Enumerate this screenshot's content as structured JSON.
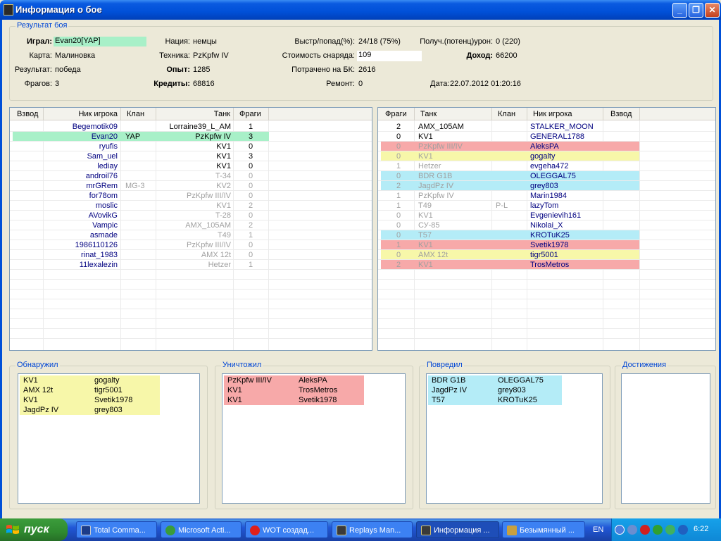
{
  "window": {
    "title": "Информация о бое"
  },
  "result_section": {
    "legend": "Результат боя",
    "played_label": "Играл:",
    "played_value": "Evan20[YAP]",
    "map_label": "Карта:",
    "map_value": "Малиновка",
    "result_label": "Результат:",
    "result_value": "победа",
    "frags_label": "Фрагов:",
    "frags_value": "3",
    "nation_label": "Нация:",
    "nation_value": "немцы",
    "tank_label": "Техника:",
    "tank_value": "PzKpfw IV",
    "xp_label": "Опыт:",
    "xp_value": "1285",
    "credits_label": "Кредиты:",
    "credits_value": "68816",
    "shots_label": "Выстр/попад(%):",
    "shots_value": "24/18 (75%)",
    "shell_cost_label": "Стоимость снаряда:",
    "shell_cost_value": "109",
    "ammo_spent_label": "Потрачено на БК:",
    "ammo_spent_value": "2616",
    "repair_label": "Ремонт:",
    "repair_value": "0",
    "dmg_label": "Получ.(потенц)урон:",
    "dmg_value": "0 (220)",
    "income_label": "Доход:",
    "income_value": "66200",
    "date_label": "Дата:",
    "date_value": "22.07.2012 01:20:16"
  },
  "left_table": {
    "headers": [
      "Взвод",
      "Ник игрока",
      "Клан",
      "Танк",
      "Фраги"
    ],
    "rows": [
      {
        "player": "Begemotik09",
        "clan": "",
        "tank": "Lorraine39_L_AM",
        "frags": "1",
        "alive": true
      },
      {
        "player": "Evan20",
        "clan": "YAP",
        "tank": "PzKpfw IV",
        "frags": "3",
        "alive": true,
        "self": true
      },
      {
        "player": "ryufis",
        "clan": "",
        "tank": "KV1",
        "frags": "0",
        "alive": true
      },
      {
        "player": "Sam_uel",
        "clan": "",
        "tank": "KV1",
        "frags": "3",
        "alive": true
      },
      {
        "player": "lediay",
        "clan": "",
        "tank": "KV1",
        "frags": "0",
        "alive": true
      },
      {
        "player": "androil76",
        "clan": "",
        "tank": "T-34",
        "frags": "0",
        "alive": false
      },
      {
        "player": "mrGRem",
        "clan": "MG-3",
        "tank": "KV2",
        "frags": "0",
        "alive": false
      },
      {
        "player": "for78om",
        "clan": "",
        "tank": "PzKpfw III/IV",
        "frags": "0",
        "alive": false
      },
      {
        "player": "moslic",
        "clan": "",
        "tank": "KV1",
        "frags": "2",
        "alive": false
      },
      {
        "player": "AVovikG",
        "clan": "",
        "tank": "T-28",
        "frags": "0",
        "alive": false
      },
      {
        "player": "Vampic",
        "clan": "",
        "tank": "AMX_105AM",
        "frags": "2",
        "alive": false
      },
      {
        "player": "asmade",
        "clan": "",
        "tank": "T49",
        "frags": "1",
        "alive": false
      },
      {
        "player": "1986110126",
        "clan": "",
        "tank": "PzKpfw III/IV",
        "frags": "0",
        "alive": false
      },
      {
        "player": "rinat_1983",
        "clan": "",
        "tank": "AMX 12t",
        "frags": "0",
        "alive": false
      },
      {
        "player": "11lexalezin",
        "clan": "",
        "tank": "Hetzer",
        "frags": "1",
        "alive": false
      }
    ]
  },
  "right_table": {
    "headers": [
      "Фраги",
      "Танк",
      "Клан",
      "Ник игрока",
      "Взвод"
    ],
    "rows": [
      {
        "frags": "2",
        "tank": "AMX_105AM",
        "clan": "",
        "player": "STALKER_MOON",
        "alive": true,
        "mark": ""
      },
      {
        "frags": "0",
        "tank": "KV1",
        "clan": "",
        "player": "GENERAL1788",
        "alive": true,
        "mark": ""
      },
      {
        "frags": "0",
        "tank": "PzKpfw III/IV",
        "clan": "",
        "player": "AleksPA",
        "alive": false,
        "mark": "killed"
      },
      {
        "frags": "0",
        "tank": "KV1",
        "clan": "",
        "player": "gogalty",
        "alive": false,
        "mark": "spotted"
      },
      {
        "frags": "1",
        "tank": "Hetzer",
        "clan": "",
        "player": "evgeha472",
        "alive": false,
        "mark": ""
      },
      {
        "frags": "0",
        "tank": "BDR G1B",
        "clan": "",
        "player": "OLEGGAL75",
        "alive": false,
        "mark": "damaged"
      },
      {
        "frags": "2",
        "tank": "JagdPz IV",
        "clan": "",
        "player": "grey803",
        "alive": false,
        "mark": "damaged"
      },
      {
        "frags": "1",
        "tank": "PzKpfw IV",
        "clan": "",
        "player": "Marin1984",
        "alive": false,
        "mark": ""
      },
      {
        "frags": "1",
        "tank": "T49",
        "clan": "P-L",
        "player": "lazyTom",
        "alive": false,
        "mark": ""
      },
      {
        "frags": "0",
        "tank": "KV1",
        "clan": "",
        "player": "Evgenievih161",
        "alive": false,
        "mark": ""
      },
      {
        "frags": "0",
        "tank": "СУ-85",
        "clan": "",
        "player": "Nikolai_X",
        "alive": false,
        "mark": ""
      },
      {
        "frags": "0",
        "tank": "T57",
        "clan": "",
        "player": "KROTuK25",
        "alive": false,
        "mark": "damaged"
      },
      {
        "frags": "1",
        "tank": "KV1",
        "clan": "",
        "player": "Svetik1978",
        "alive": false,
        "mark": "killed"
      },
      {
        "frags": "0",
        "tank": "AMX 12t",
        "clan": "",
        "player": "tigr5001",
        "alive": false,
        "mark": "spotted"
      },
      {
        "frags": "2",
        "tank": "KV1",
        "clan": "",
        "player": "TrosMetros",
        "alive": false,
        "mark": "killed"
      }
    ]
  },
  "spotted": {
    "legend": "Обнаружил",
    "rows": [
      {
        "tank": "KV1",
        "player": "gogalty"
      },
      {
        "tank": "AMX 12t",
        "player": "tigr5001"
      },
      {
        "tank": "KV1",
        "player": "Svetik1978"
      },
      {
        "tank": "JagdPz IV",
        "player": "grey803"
      }
    ]
  },
  "destroyed": {
    "legend": "Уничтожил",
    "rows": [
      {
        "tank": "PzKpfw III/IV",
        "player": "AleksPA"
      },
      {
        "tank": "KV1",
        "player": "TrosMetros"
      },
      {
        "tank": "KV1",
        "player": "Svetik1978"
      }
    ]
  },
  "damaged": {
    "legend": "Повредил",
    "rows": [
      {
        "tank": "BDR G1B",
        "player": "OLEGGAL75"
      },
      {
        "tank": "JagdPz IV",
        "player": "grey803"
      },
      {
        "tank": "T57",
        "player": "KROTuK25"
      }
    ]
  },
  "achievements": {
    "legend": "Достижения"
  },
  "colors": {
    "self": "#a8f0c8",
    "killed": "#f7a9a9",
    "spotted": "#f7f7a9",
    "damaged": "#b4ecf7"
  },
  "taskbar": {
    "start_label": "пуск",
    "items": [
      "Total Comma...",
      "Microsoft Acti...",
      "WOT создад...",
      "Replays Man...",
      "Информация ...",
      "Безымянный ..."
    ],
    "lang": "EN",
    "clock": "6:22"
  }
}
